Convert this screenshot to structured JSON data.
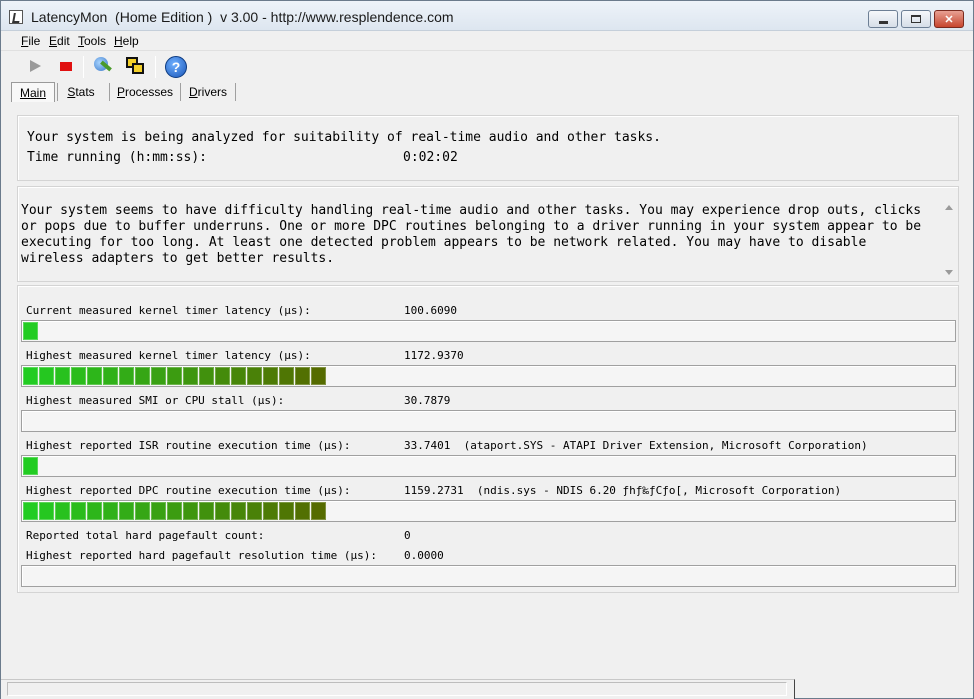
{
  "window": {
    "title": "LatencyMon  (Home Edition )  v 3.00 - http://www.resplendence.com"
  },
  "menu": {
    "items": [
      {
        "prefix": "",
        "ul": "F",
        "rest": "ile"
      },
      {
        "prefix": "",
        "ul": "E",
        "rest": "dit"
      },
      {
        "prefix": "",
        "ul": "T",
        "rest": "ools"
      },
      {
        "prefix": "",
        "ul": "H",
        "rest": "elp"
      }
    ]
  },
  "toolbar": {
    "icons": [
      "play-icon",
      "stop-icon",
      "tools-icon",
      "windows-icon",
      "help-icon"
    ]
  },
  "tabs": {
    "main": {
      "ul": "M",
      "rest": "ain"
    },
    "stats": {
      "ul": "S",
      "rest": "tats"
    },
    "processes": {
      "ul": "P",
      "rest": "rocesses"
    },
    "drivers": {
      "ul": "D",
      "rest": "rivers"
    }
  },
  "status": {
    "analyzing": "Your system is being analyzed for suitability of real-time audio and other tasks.",
    "time_label": "Time running (h:mm:ss):",
    "time_value": "0:02:02"
  },
  "message": "Your system seems to have difficulty handling real-time audio and other tasks. You may experience drop outs, clicks or pops due to buffer underruns. One or more DPC routines belonging to a driver running in your system appear to be executing for too long. At least one detected problem appears to be network related. You may have to disable wireless adapters to get better results.",
  "metrics": {
    "kernel_current": {
      "label": "Current measured kernel timer latency (µs):",
      "value": "100.6090",
      "level": 0.06
    },
    "kernel_highest": {
      "label": "Highest measured kernel timer latency (µs):",
      "value": "1172.9370",
      "level": 1.0
    },
    "smi_stall": {
      "label": "Highest measured SMI or CPU stall (µs):",
      "value": "30.7879",
      "level": 0.0
    },
    "isr": {
      "label": "Highest reported ISR routine execution time (µs):",
      "value": "33.7401",
      "detail": "(ataport.SYS - ATAPI Driver Extension, Microsoft Corporation)",
      "level": 0.03
    },
    "dpc": {
      "label": "Highest reported DPC routine execution time (µs):",
      "value": "1159.2731",
      "detail": "(ndis.sys - NDIS 6.20 ƒhƒ‰ƒCƒo[, Microsoft Corporation)",
      "level": 1.0
    },
    "pagefault_count": {
      "label": "Reported total hard pagefault count:",
      "value": "0"
    },
    "pagefault_time": {
      "label": "Highest reported hard pagefault resolution time (µs):",
      "value": "0.0000",
      "level": 0.0
    }
  },
  "colors": {
    "bar_start": "#22cc22",
    "bar_end": "#556b00",
    "close_button": "#c7452f"
  }
}
